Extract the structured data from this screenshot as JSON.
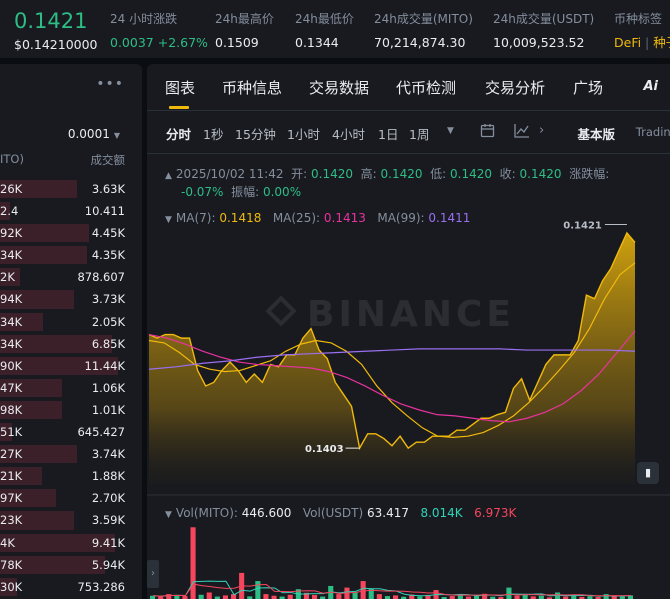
{
  "ticker": {
    "price": "0.1421",
    "price_usd": "$0.14210000",
    "stats": [
      {
        "label": "24 小时涨跌",
        "value_change": "0.0037",
        "value_pct": "+2.67%"
      },
      {
        "label": "24h最高价",
        "value": "0.1509"
      },
      {
        "label": "24h最低价",
        "value": "0.1344"
      },
      {
        "label": "24h成交量(MITO)",
        "value": "70,214,874.30"
      },
      {
        "label": "24h成交量(USDT)",
        "value": "10,009,523.52"
      },
      {
        "label": "币种标签",
        "tag1": "DeFi",
        "tag2": "种子"
      }
    ]
  },
  "order_book": {
    "menu_icon": "more-dots-icon",
    "precision": "0.0001",
    "col_qty": "ITO)",
    "col_total": "成交额",
    "rows": [
      {
        "qty": "26K",
        "total": "3.63K",
        "depth": 0.62
      },
      {
        "qty": "2.4",
        "total": "10.411",
        "depth": 0.08
      },
      {
        "qty": "92K",
        "total": "4.45K",
        "depth": 0.72
      },
      {
        "qty": "34K",
        "total": "4.35K",
        "depth": 0.7
      },
      {
        "qty": "2K",
        "total": "878.607",
        "depth": 0.16
      },
      {
        "qty": "94K",
        "total": "3.73K",
        "depth": 0.6
      },
      {
        "qty": "34K",
        "total": "2.05K",
        "depth": 0.35
      },
      {
        "qty": "34K",
        "total": "6.85K",
        "depth": 0.9
      },
      {
        "qty": "90K",
        "total": "11.44K",
        "depth": 0.95
      },
      {
        "qty": "47K",
        "total": "1.06K",
        "depth": 0.5
      },
      {
        "qty": "98K",
        "total": "1.01K",
        "depth": 0.5
      },
      {
        "qty": "51K",
        "total": "645.427",
        "depth": 0.1
      },
      {
        "qty": "27K",
        "total": "3.74K",
        "depth": 0.62
      },
      {
        "qty": "21K",
        "total": "1.88K",
        "depth": 0.34
      },
      {
        "qty": "97K",
        "total": "2.70K",
        "depth": 0.45
      },
      {
        "qty": "23K",
        "total": "3.59K",
        "depth": 0.6
      },
      {
        "qty": "4K",
        "total": "9.41K",
        "depth": 0.93
      },
      {
        "qty": "78K",
        "total": "5.94K",
        "depth": 0.85
      },
      {
        "qty": "30K",
        "total": "753.286",
        "depth": 0.14
      }
    ]
  },
  "tabs": [
    "图表",
    "币种信息",
    "交易数据",
    "代币检测",
    "交易分析",
    "广场"
  ],
  "ai_label": "Ai",
  "toolbar": {
    "intervals": [
      "分时",
      "1秒",
      "15分钟",
      "1小时",
      "4小时",
      "1日",
      "1周"
    ],
    "basic_label": "基本版",
    "tv_label": "Trading"
  },
  "chart_legend": {
    "datetime": "2025/10/02 11:42",
    "open_label": "开:",
    "open": "0.1420",
    "high_label": "高:",
    "high": "0.1420",
    "low_label": "低:",
    "low": "0.1420",
    "close_label": "收:",
    "close": "0.1420",
    "change_label": "涨跌幅:",
    "change": "-0.07%",
    "amp_label": "振幅:",
    "amp": "0.00%",
    "ma7_label": "MA(7):",
    "ma7": "0.1418",
    "ma25_label": "MA(25):",
    "ma25": "0.1413",
    "ma99_label": "MA(99):",
    "ma99": "0.1411",
    "vol_label": "Vol(MITO):",
    "vol": "446.600",
    "volusdt_label": "Vol(USDT)",
    "volusdt": "63.417",
    "vol_ma1": "8.014K",
    "vol_ma2": "6.973K",
    "high_marker": "0.1421",
    "low_marker": "0.1403",
    "watermark": "BINANCE"
  },
  "chart_data": {
    "type": "area",
    "title": "",
    "xlabel": "",
    "ylabel": "",
    "ylim": [
      0.14,
      0.1423
    ],
    "series": [
      {
        "values": [
          0.14125,
          0.14122,
          0.14125,
          0.14125,
          0.14122,
          0.14122,
          0.14095,
          0.14082,
          0.14085,
          0.14095,
          0.14102,
          0.14095,
          0.14085,
          0.14092,
          0.14085,
          0.141,
          0.14098,
          0.14108,
          0.14108,
          0.14122,
          0.1413,
          0.14112,
          0.14105,
          0.14085,
          0.14075,
          0.14065,
          0.1403,
          0.14042,
          0.14042,
          0.14038,
          0.14032,
          0.1404,
          0.1403,
          0.14035,
          0.14035,
          0.1404,
          0.1404,
          0.1404,
          0.14045,
          0.14045,
          0.1405,
          0.14055,
          0.14055,
          0.14058,
          0.1406,
          0.1408,
          0.14088,
          0.1407,
          0.14085,
          0.141,
          0.14108,
          0.14108,
          0.14108,
          0.1412,
          0.14158,
          0.14155,
          0.1417,
          0.1418,
          0.14195,
          0.1421,
          0.14202
        ]
      },
      {
        "name": "MA(7)",
        "values": [
          0.1412,
          0.14118,
          0.1411,
          0.141,
          0.14096,
          0.14094,
          0.14095,
          0.14099,
          0.14103,
          0.14111,
          0.14117,
          0.1412,
          0.14118,
          0.14111,
          0.141,
          0.14082,
          0.14068,
          0.14057,
          0.14047,
          0.1404,
          0.14039,
          0.1404,
          0.14043,
          0.14049,
          0.14057,
          0.14068,
          0.14081,
          0.14095,
          0.1411,
          0.1413,
          0.14155,
          0.14175,
          0.14185
        ]
      },
      {
        "name": "MA(25)",
        "values": [
          0.14125,
          0.14122,
          0.14117,
          0.14111,
          0.14106,
          0.14102,
          0.141,
          0.14099,
          0.14098,
          0.14097,
          0.14094,
          0.14089,
          0.14082,
          0.14074,
          0.14067,
          0.14062,
          0.14058,
          0.14057,
          0.14055,
          0.14053,
          0.14052,
          0.14055,
          0.1406,
          0.14067,
          0.14078,
          0.14092,
          0.1411,
          0.14128
        ]
      },
      {
        "name": "MA(99)",
        "values": [
          0.14096,
          0.14098,
          0.14101,
          0.14103,
          0.14106,
          0.14108,
          0.14109,
          0.1411,
          0.14111,
          0.14112,
          0.14113,
          0.14113,
          0.14113,
          0.14113,
          0.14112,
          0.14112,
          0.14112,
          0.14112,
          0.14111
        ]
      }
    ],
    "volume_ylim": [
      0,
      46000
    ],
    "volume": [
      {
        "v": 2000,
        "up": true
      },
      {
        "v": 1500,
        "up": false
      },
      {
        "v": 3000,
        "up": false
      },
      {
        "v": 2500,
        "up": true
      },
      {
        "v": 1800,
        "up": false
      },
      {
        "v": 44000,
        "up": false
      },
      {
        "v": 2600,
        "up": true
      },
      {
        "v": 4000,
        "up": false
      },
      {
        "v": 1500,
        "up": true
      },
      {
        "v": 2200,
        "up": false
      },
      {
        "v": 3000,
        "up": false
      },
      {
        "v": 16000,
        "up": false
      },
      {
        "v": 1600,
        "up": true
      },
      {
        "v": 11000,
        "up": true
      },
      {
        "v": 3000,
        "up": false
      },
      {
        "v": 2000,
        "up": false
      },
      {
        "v": 1500,
        "up": true
      },
      {
        "v": 2600,
        "up": false
      },
      {
        "v": 6000,
        "up": true
      },
      {
        "v": 3800,
        "up": false
      },
      {
        "v": 2500,
        "up": false
      },
      {
        "v": 1500,
        "up": true
      },
      {
        "v": 8000,
        "up": true
      },
      {
        "v": 3000,
        "up": false
      },
      {
        "v": 7000,
        "up": false
      },
      {
        "v": 4000,
        "up": true
      },
      {
        "v": 11000,
        "up": false
      },
      {
        "v": 6500,
        "up": true
      },
      {
        "v": 3000,
        "up": false
      },
      {
        "v": 1800,
        "up": true
      },
      {
        "v": 2200,
        "up": false
      },
      {
        "v": 1400,
        "up": true
      },
      {
        "v": 2800,
        "up": false
      },
      {
        "v": 1600,
        "up": true
      },
      {
        "v": 2500,
        "up": false
      },
      {
        "v": 5500,
        "up": false
      },
      {
        "v": 1200,
        "up": true
      },
      {
        "v": 1800,
        "up": false
      },
      {
        "v": 3000,
        "up": true
      },
      {
        "v": 1500,
        "up": false
      },
      {
        "v": 2600,
        "up": true
      },
      {
        "v": 3200,
        "up": false
      },
      {
        "v": 1400,
        "up": true
      },
      {
        "v": 1200,
        "up": false
      },
      {
        "v": 7000,
        "up": true
      },
      {
        "v": 2000,
        "up": false
      },
      {
        "v": 3000,
        "up": true
      },
      {
        "v": 1600,
        "up": false
      },
      {
        "v": 2000,
        "up": true
      },
      {
        "v": 1000,
        "up": false
      },
      {
        "v": 4000,
        "up": true
      },
      {
        "v": 1500,
        "up": false
      },
      {
        "v": 2800,
        "up": true
      },
      {
        "v": 1300,
        "up": false
      },
      {
        "v": 1800,
        "up": true
      },
      {
        "v": 1200,
        "up": false
      },
      {
        "v": 3000,
        "up": true
      },
      {
        "v": 2000,
        "up": false
      },
      {
        "v": 1600,
        "up": true
      },
      {
        "v": 2200,
        "up": true
      }
    ],
    "colors": {
      "area": "#f0b90b",
      "ma7": "#f0b90b",
      "ma25": "#e6339d",
      "ma99": "#9a6ff0",
      "up": "#2ebd85",
      "down": "#f6465d",
      "vol_ma1": "#32d4b8",
      "vol_ma2": "#f6465d"
    }
  }
}
